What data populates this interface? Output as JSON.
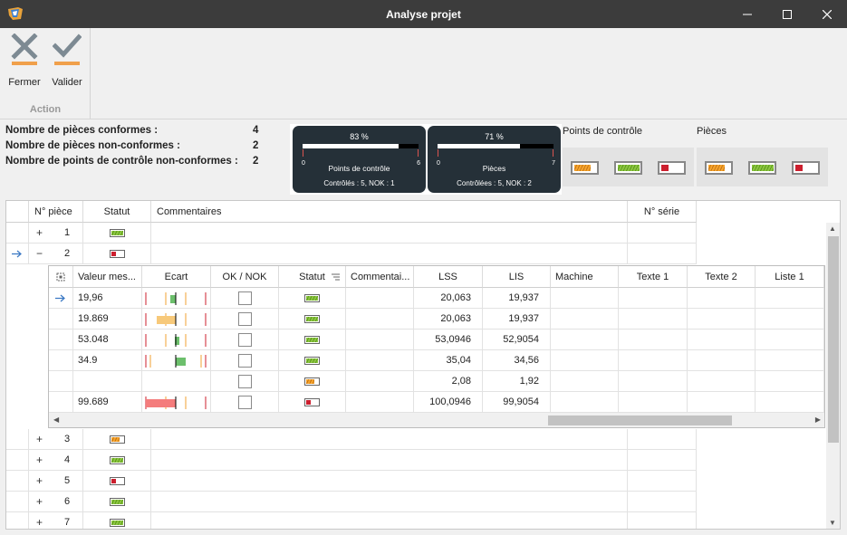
{
  "window": {
    "title": "Analyse projet"
  },
  "ribbon": {
    "buttons": [
      {
        "label": "Fermer",
        "icon": "close-x-icon"
      },
      {
        "label": "Valider",
        "icon": "checkmark-icon"
      }
    ],
    "group_label": "Action"
  },
  "summary": [
    {
      "label": "Nombre de pièces conformes :",
      "value": "4"
    },
    {
      "label": "Nombre de pièces non-conformes :",
      "value": "2"
    },
    {
      "label": "Nombre de points de contrôle non-conformes :",
      "value": "2"
    }
  ],
  "gauges": [
    {
      "pct_label": "83 %",
      "fraction": 0.83,
      "min": "0",
      "max": "6",
      "name": "Points de contrôle",
      "detail": "Contrôlés : 5, NOK : 1"
    },
    {
      "pct_label": "71 %",
      "fraction": 0.71,
      "min": "0",
      "max": "7",
      "name": "Pièces",
      "detail": "Contrôlées : 5, NOK : 2"
    }
  ],
  "legends": [
    {
      "title": "Points de contrôle"
    },
    {
      "title": "Pièces"
    }
  ],
  "colors": {
    "green": "#8cc63f",
    "orange": "#f7a52b",
    "red": "#cc1f2e",
    "gauge_bg": "#253038"
  },
  "grid": {
    "columns": [
      "N° pièce",
      "Statut",
      "Commentaires",
      "N° série"
    ],
    "rows": [
      {
        "expander": "+",
        "num": "1",
        "status": "green"
      },
      {
        "expander": "−",
        "num": "2",
        "status": "red"
      },
      {
        "expander": "+",
        "num": "3",
        "status": "orange"
      },
      {
        "expander": "+",
        "num": "4",
        "status": "green"
      },
      {
        "expander": "+",
        "num": "5",
        "status": "red"
      },
      {
        "expander": "+",
        "num": "6",
        "status": "green"
      },
      {
        "expander": "+",
        "num": "7",
        "status": "green"
      }
    ]
  },
  "detail": {
    "columns": [
      "Valeur mes...",
      "Ecart",
      "OK / NOK",
      "Statut",
      "Commentai...",
      "LSS",
      "LIS",
      "Machine",
      "Texte 1",
      "Texte 2",
      "Liste 1"
    ],
    "rows": [
      {
        "value": "19,96",
        "lss": "20,063",
        "lis": "19,937",
        "status": "green",
        "current": true
      },
      {
        "value": "19.869",
        "lss": "20,063",
        "lis": "19,937",
        "status": "green",
        "current": false
      },
      {
        "value": "53.048",
        "lss": "53,0946",
        "lis": "52,9054",
        "status": "green",
        "current": false
      },
      {
        "value": "34.9",
        "lss": "35,04",
        "lis": "34,56",
        "status": "green",
        "current": false
      },
      {
        "value": "",
        "lss": "2,08",
        "lis": "1,92",
        "status": "orange",
        "current": false
      },
      {
        "value": "99.689",
        "lss": "100,0946",
        "lis": "99,9054",
        "status": "red",
        "current": false
      }
    ]
  }
}
